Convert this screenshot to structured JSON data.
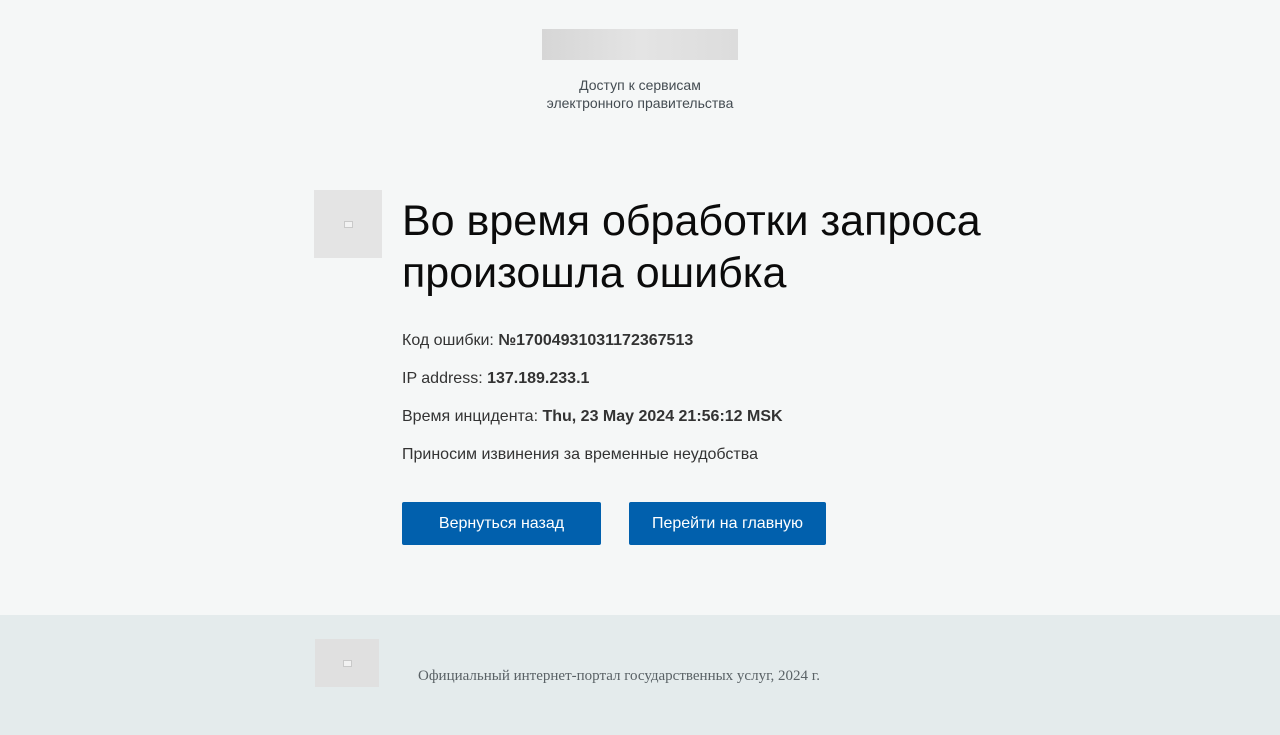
{
  "header": {
    "tagline_line1": "Доступ к сервисам",
    "tagline_line2": "электронного правительства"
  },
  "error": {
    "title": "Во время обработки запроса произошла ошибка",
    "code_label": "Код ошибки: ",
    "code_value": "№17004931031172367513",
    "ip_label": "IP address: ",
    "ip_value": "137.189.233.1",
    "time_label": "Время инцидента: ",
    "time_value": "Thu, 23 May 2024 21:56:12 MSK",
    "apology": "Приносим извинения за временные неудобства"
  },
  "buttons": {
    "back_label": "Вернуться назад",
    "home_label": "Перейти на главную"
  },
  "footer": {
    "text": "Официальный интернет-портал государственных услуг, 2024 г."
  },
  "colors": {
    "primary_button": "#0160ad",
    "page_background": "#f5f7f7",
    "footer_background": "#e4ebec"
  }
}
